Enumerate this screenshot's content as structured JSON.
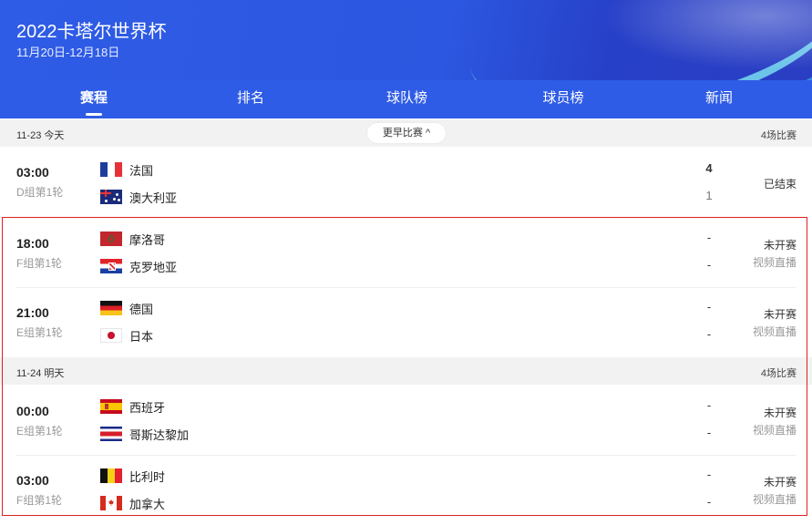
{
  "header": {
    "title": "2022卡塔尔世界杯",
    "date_range": "11月20日-12月18日"
  },
  "tabs": [
    {
      "label": "赛程",
      "active": true
    },
    {
      "label": "排名",
      "active": false
    },
    {
      "label": "球队榜",
      "active": false
    },
    {
      "label": "球员榜",
      "active": false
    },
    {
      "label": "新闻",
      "active": false
    }
  ],
  "days": [
    {
      "date": "11-23 今天",
      "more_label": "更早比赛",
      "count": "4场比赛"
    },
    {
      "date": "11-24 明天",
      "count": "4场比赛"
    }
  ],
  "matches": [
    {
      "time": "03:00",
      "round": "D组第1轮",
      "home": "法国",
      "away": "澳大利亚",
      "home_score": "4",
      "away_score": "1",
      "status": "已结束",
      "live": ""
    },
    {
      "time": "18:00",
      "round": "F组第1轮",
      "home": "摩洛哥",
      "away": "克罗地亚",
      "home_score": "-",
      "away_score": "-",
      "status": "未开赛",
      "live": "视频直播"
    },
    {
      "time": "21:00",
      "round": "E组第1轮",
      "home": "德国",
      "away": "日本",
      "home_score": "-",
      "away_score": "-",
      "status": "未开赛",
      "live": "视频直播"
    },
    {
      "time": "00:00",
      "round": "E组第1轮",
      "home": "西班牙",
      "away": "哥斯达黎加",
      "home_score": "-",
      "away_score": "-",
      "status": "未开赛",
      "live": "视频直播"
    },
    {
      "time": "03:00",
      "round": "F组第1轮",
      "home": "比利时",
      "away": "加拿大",
      "home_score": "-",
      "away_score": "-",
      "status": "未开赛",
      "live": "视频直播"
    }
  ],
  "colors": {
    "header_blue": "#2f5ce6",
    "highlight_red": "#e02020"
  }
}
